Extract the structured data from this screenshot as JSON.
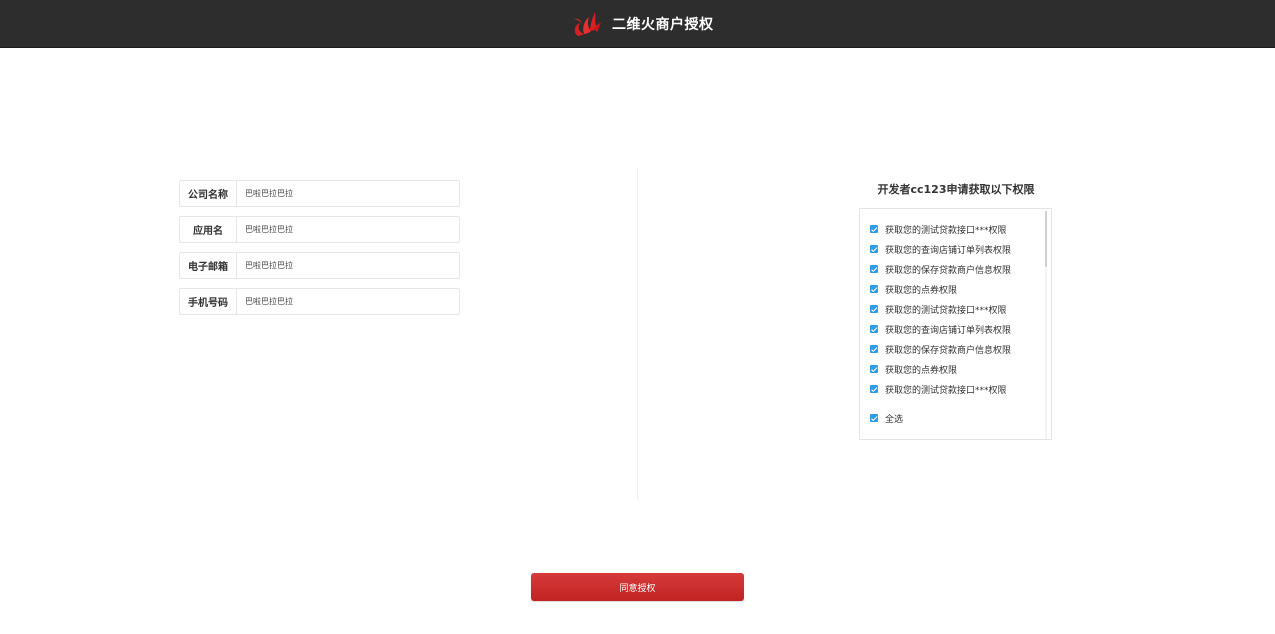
{
  "header": {
    "title": "二维火商户授权",
    "logo_icon": "flame-logo-icon",
    "background_color": "#2d2d2d"
  },
  "form": {
    "fields": [
      {
        "label": "公司名称",
        "value": "巴啦巴拉巴拉"
      },
      {
        "label": "应用名",
        "value": "巴啦巴拉巴拉"
      },
      {
        "label": "电子邮箱",
        "value": "巴啦巴拉巴拉"
      },
      {
        "label": "手机号码",
        "value": "巴啦巴拉巴拉"
      }
    ]
  },
  "permissions": {
    "title": "开发者cc123申请获取以下权限",
    "items": [
      {
        "label": "获取您的测试贷款接口***权限",
        "checked": true
      },
      {
        "label": "获取您的查询店铺订单列表权限",
        "checked": true
      },
      {
        "label": "获取您的保存贷款商户信息权限",
        "checked": true
      },
      {
        "label": "获取您的点券权限",
        "checked": true
      },
      {
        "label": "获取您的测试贷款接口***权限",
        "checked": true
      },
      {
        "label": "获取您的查询店铺订单列表权限",
        "checked": true
      },
      {
        "label": "获取您的保存贷款商户信息权限",
        "checked": true
      },
      {
        "label": "获取您的点券权限",
        "checked": true
      },
      {
        "label": "获取您的测试贷款接口***权限",
        "checked": true
      }
    ],
    "select_all_label": "全选",
    "select_all_checked": true,
    "checkbox_color": "#2d9bea"
  },
  "actions": {
    "agree_label": "同意授权",
    "agree_color": "#c92c2c"
  }
}
